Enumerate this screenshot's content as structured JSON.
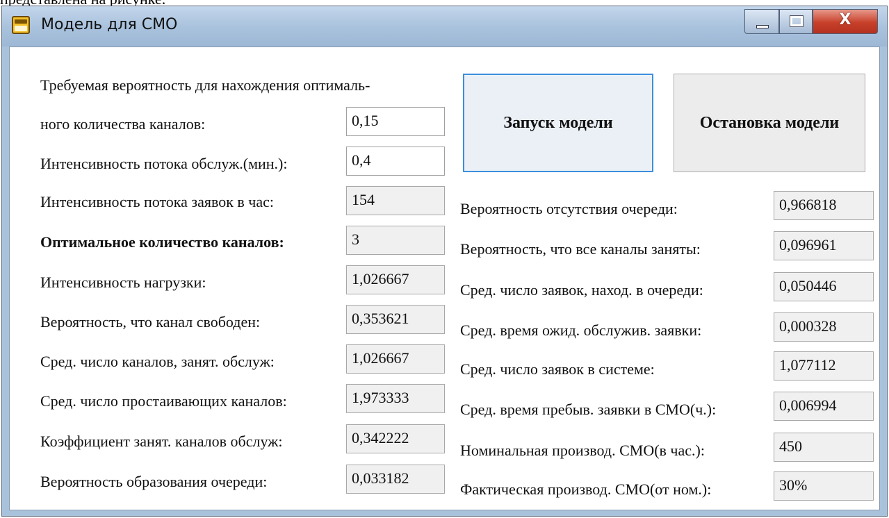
{
  "document_fragment": "представлена на рисунке.",
  "window": {
    "title": "Модель для СМО",
    "close_glyph": "X"
  },
  "params": {
    "probability_label_line1": "Требуемая вероятность для нахождения оптималь-",
    "probability_label_line2": "ного количества каналов:",
    "probability_value": "0,15",
    "service_intensity_label": "Интенсивность потока обслуж.(мин.):",
    "service_intensity_value": "0,4"
  },
  "buttons": {
    "start": "Запуск модели",
    "stop": "Остановка модели"
  },
  "left_results": [
    {
      "label": "Интенсивность потока заявок в час:",
      "value": "154",
      "bold": false
    },
    {
      "label": "Оптимальное количество каналов:",
      "value": "3",
      "bold": true
    },
    {
      "label": "Интенсивность нагрузки:",
      "value": "1,026667",
      "bold": false
    },
    {
      "label": "Вероятность, что канал свободен:",
      "value": "0,353621",
      "bold": false
    },
    {
      "label": "Сред. число каналов, занят. обслуж:",
      "value": "1,026667",
      "bold": false
    },
    {
      "label": "Сред. число простаивающих каналов:",
      "value": "1,973333",
      "bold": false
    },
    {
      "label": "Коэффициент занят. каналов обслуж:",
      "value": "0,342222",
      "bold": false
    },
    {
      "label": "Вероятность образования очереди:",
      "value": "0,033182",
      "bold": false
    }
  ],
  "right_results": [
    {
      "label": "Вероятность отсутствия очереди:",
      "value": "0,966818"
    },
    {
      "label": "Вероятность, что все каналы заняты:",
      "value": "0,096961"
    },
    {
      "label": "Сред. число заявок, наход. в очереди:",
      "value": "0,050446"
    },
    {
      "label": "Сред. время ожид. обслужив. заявки:",
      "value": "0,000328"
    },
    {
      "label": "Сред. число заявок в системе:",
      "value": "1,077112"
    },
    {
      "label": "Сред. время пребыв. заявки в СМО(ч.):",
      "value": "0,006994"
    },
    {
      "label": "Номинальная производ. СМО(в час.):",
      "value": "450"
    },
    {
      "label": "Фактическая производ. СМО(от ном.):",
      "value": "30%"
    }
  ],
  "colors": {
    "titlebar": "#a8c1dc",
    "close_button": "#c7402a",
    "focus_border": "#3c8fdc",
    "readonly_field": "#f0f0f0"
  }
}
